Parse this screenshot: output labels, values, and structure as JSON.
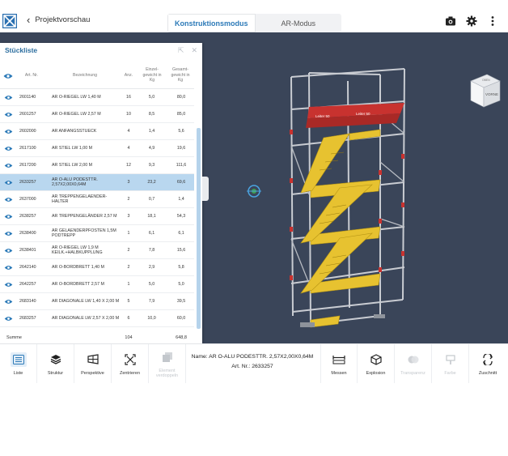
{
  "header": {
    "back_label": "Projektvorschau",
    "modes": [
      "Konstruktionsmodus",
      "AR-Modus"
    ],
    "active_mode": "Konstruktionsmodus"
  },
  "view_cube": {
    "face_label": "VORNE",
    "top_label": "OBEN"
  },
  "parts_list": {
    "title": "Stückliste",
    "columns": {
      "art_nr": "Art. Nr.",
      "bezeichnung": "Bezeichnung",
      "anzahl": "Anz.",
      "einzelgewicht": "Einzel- gewicht in Kg",
      "gesamtgewicht": "Gesamt- gewicht in Kg"
    },
    "rows": [
      {
        "art_nr": "2601140",
        "bezeichnung": "AR O-RIEGEL LW 1,40 M",
        "anzahl": "16",
        "einzel": "5,0",
        "gesamt": "80,0",
        "selected": false
      },
      {
        "art_nr": "2601257",
        "bezeichnung": "AR O-RIEGEL LW 2,57 M",
        "anzahl": "10",
        "einzel": "8,5",
        "gesamt": "85,0",
        "selected": false
      },
      {
        "art_nr": "2602000",
        "bezeichnung": "AR ANFANGSSTUECK",
        "anzahl": "4",
        "einzel": "1,4",
        "gesamt": "5,6",
        "selected": false
      },
      {
        "art_nr": "2617100",
        "bezeichnung": "AR STIEL LW 1,00 M",
        "anzahl": "4",
        "einzel": "4,9",
        "gesamt": "19,6",
        "selected": false
      },
      {
        "art_nr": "2617200",
        "bezeichnung": "AR STIEL LW 2,00 M",
        "anzahl": "12",
        "einzel": "9,3",
        "gesamt": "111,6",
        "selected": false
      },
      {
        "art_nr": "2633257",
        "bezeichnung": "AR O-ALU PODESTTR. 2,57X2,00X0,64M",
        "anzahl": "3",
        "einzel": "23,2",
        "gesamt": "69,6",
        "selected": true
      },
      {
        "art_nr": "2637000",
        "bezeichnung": "AR TREPPENGELAENDER-HALTER",
        "anzahl": "2",
        "einzel": "0,7",
        "gesamt": "1,4",
        "selected": false
      },
      {
        "art_nr": "2638257",
        "bezeichnung": "AR TREPPENGELÄNDER 2,57 M",
        "anzahl": "3",
        "einzel": "18,1",
        "gesamt": "54,3",
        "selected": false
      },
      {
        "art_nr": "2638400",
        "bezeichnung": "AR GELAENDERPFOSTEN 1,5M PODTREPP",
        "anzahl": "1",
        "einzel": "6,1",
        "gesamt": "6,1",
        "selected": false
      },
      {
        "art_nr": "2638401",
        "bezeichnung": "AR O-RIEGEL LW 1,9 M KEILK.+HALBKUPPLUNG",
        "anzahl": "2",
        "einzel": "7,8",
        "gesamt": "15,6",
        "selected": false
      },
      {
        "art_nr": "2642140",
        "bezeichnung": "AR O-BORDBRETT 1,40 M",
        "anzahl": "2",
        "einzel": "2,9",
        "gesamt": "5,8",
        "selected": false
      },
      {
        "art_nr": "2642257",
        "bezeichnung": "AR O-BORDBRETT 2,57 M",
        "anzahl": "1",
        "einzel": "5,0",
        "gesamt": "5,0",
        "selected": false
      },
      {
        "art_nr": "2683140",
        "bezeichnung": "AR DIAGONALE LW 1,40 X 2,00 M",
        "anzahl": "5",
        "einzel": "7,9",
        "gesamt": "39,5",
        "selected": false
      },
      {
        "art_nr": "2683257",
        "bezeichnung": "AR DIAGONALE LW 2,57 X 2,00 M",
        "anzahl": "6",
        "einzel": "10,0",
        "gesamt": "60,0",
        "selected": false
      }
    ],
    "sum": {
      "label": "Summe",
      "anzahl": "104",
      "gesamt": "648,8"
    }
  },
  "toolbar": {
    "left": [
      {
        "label": "Liste",
        "icon": "list-icon",
        "active": true,
        "enabled": true
      },
      {
        "label": "Struktur",
        "icon": "layers-icon",
        "active": false,
        "enabled": true
      },
      {
        "label": "Perspektive",
        "icon": "perspective-icon",
        "active": false,
        "enabled": true
      },
      {
        "label": "Zentrieren",
        "icon": "center-icon",
        "active": false,
        "enabled": true
      },
      {
        "label": "Element verdoppeln",
        "icon": "duplicate-icon",
        "active": false,
        "enabled": false
      }
    ],
    "info_name": "Name: AR O-ALU PODESTTR. 2,57X2,00X0,64M",
    "info_art": "Art. Nr.: 2633257",
    "right": [
      {
        "label": "Messen",
        "icon": "measure-icon",
        "enabled": true
      },
      {
        "label": "Explosion",
        "icon": "explode-icon",
        "enabled": true
      },
      {
        "label": "Transparenz",
        "icon": "transparency-icon",
        "enabled": false
      },
      {
        "label": "Farbe",
        "icon": "color-icon",
        "enabled": false
      },
      {
        "label": "Zuschnitt",
        "icon": "cut-icon",
        "enabled": true
      }
    ]
  },
  "model_labels": [
    "Leiter 50",
    "Leiter 50"
  ],
  "colors": {
    "accent": "#2c7ab8",
    "viewport": "#3a4559",
    "selection": "#b9d7ef",
    "stair": "#e7c230",
    "guard": "#c8322f"
  }
}
